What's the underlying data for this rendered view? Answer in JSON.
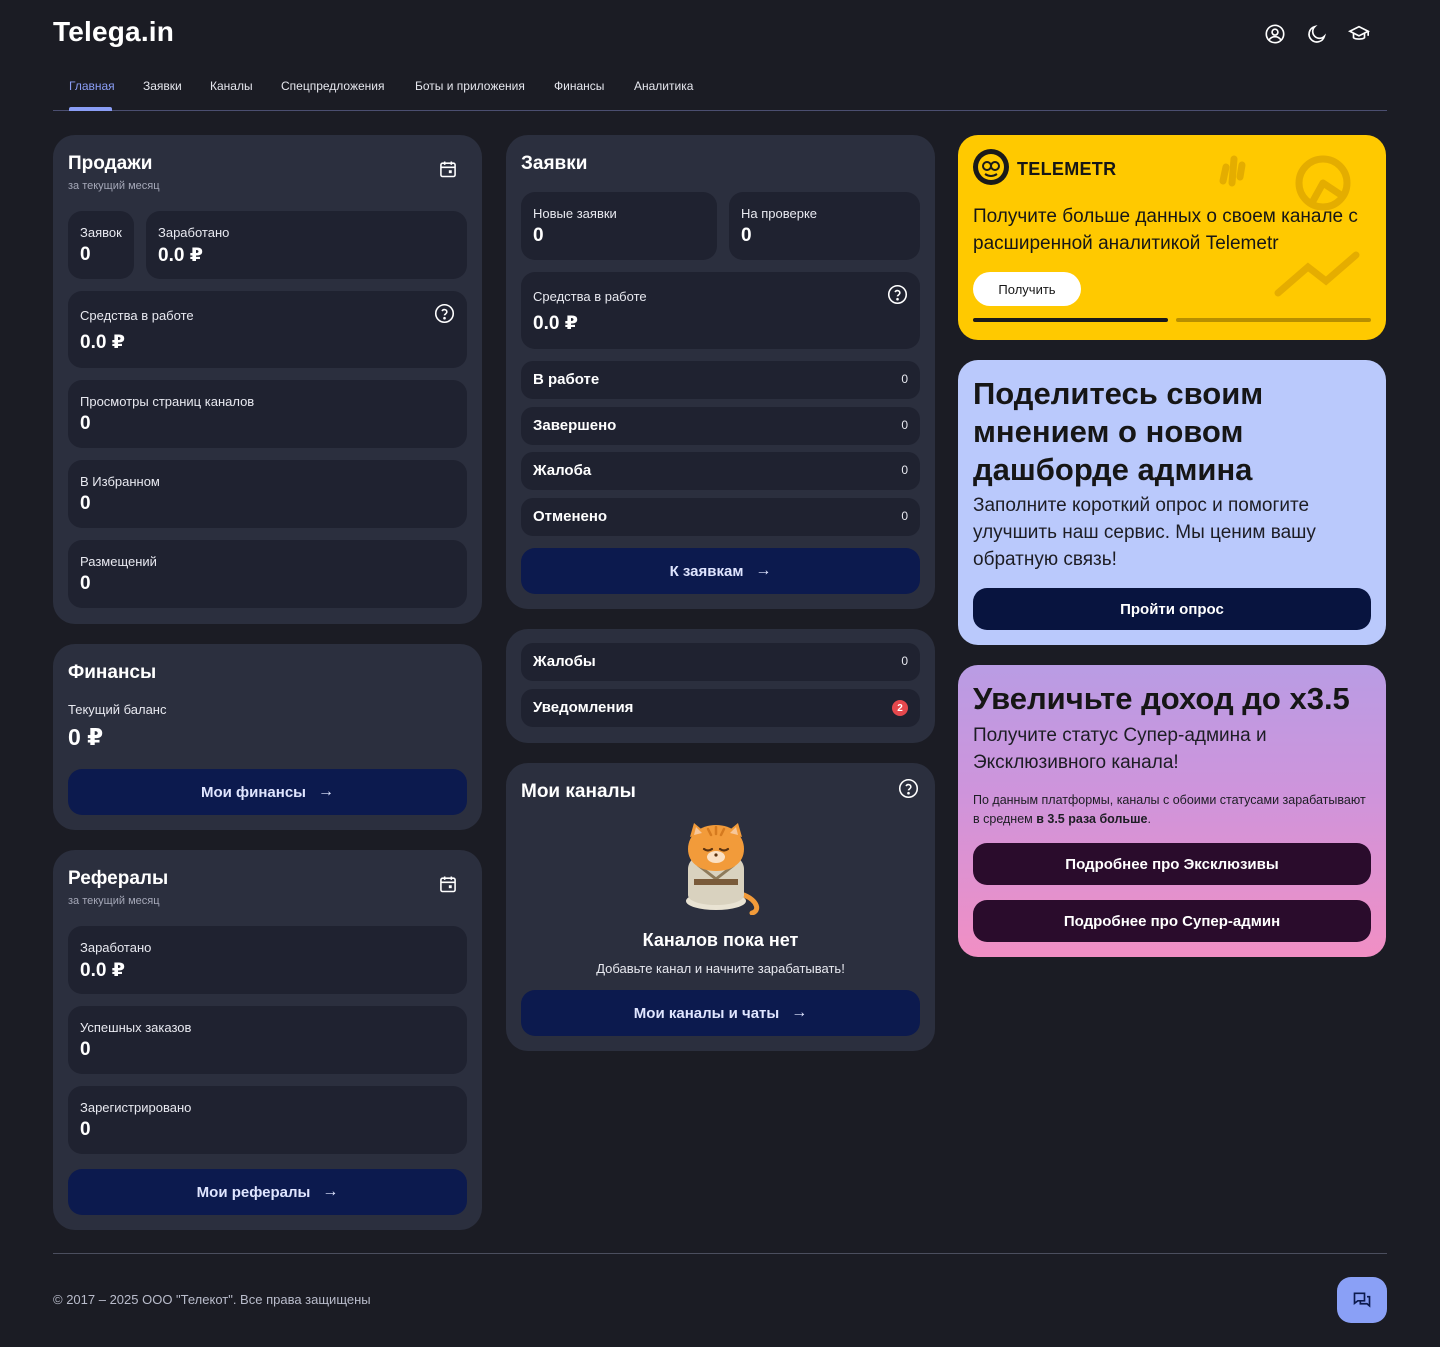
{
  "app": {
    "logo": "Telega.in"
  },
  "header_icons": [
    "user-circle-icon",
    "moon-icon",
    "graduation-cap-icon"
  ],
  "nav": {
    "items": [
      {
        "label": "Главная",
        "active": true
      },
      {
        "label": "Заявки"
      },
      {
        "label": "Каналы"
      },
      {
        "label": "Спецпредложения"
      },
      {
        "label": "Боты и приложения"
      },
      {
        "label": "Финансы"
      },
      {
        "label": "Аналитика"
      }
    ]
  },
  "sales": {
    "title": "Продажи",
    "subtitle": "за текущий месяц",
    "tiles": [
      {
        "label": "Заявок",
        "value": "0"
      },
      {
        "label": "Заработано",
        "value": "0.0 ₽"
      },
      {
        "label": "Средства в работе",
        "value": "0.0 ₽"
      },
      {
        "label": "Просмотры страниц каналов",
        "value": "0"
      },
      {
        "label": "В Избранном",
        "value": "0"
      },
      {
        "label": "Размещений",
        "value": "0"
      }
    ]
  },
  "finances": {
    "title": "Финансы",
    "balance_label": "Текущий баланс",
    "balance_value": "0 ₽",
    "button": "Мои финансы"
  },
  "referrals": {
    "title": "Рефералы",
    "subtitle": "за текущий месяц",
    "tiles": [
      {
        "label": "Заработано",
        "value": "0.0 ₽"
      },
      {
        "label": "Успешных заказов",
        "value": "0"
      },
      {
        "label": "Зарегистрировано",
        "value": "0"
      }
    ],
    "button": "Мои рефералы"
  },
  "requests": {
    "title": "Заявки",
    "tiles": [
      {
        "label": "Новые заявки",
        "value": "0"
      },
      {
        "label": "На проверке",
        "value": "0"
      },
      {
        "label": "Средства в работе",
        "value": "0.0 ₽"
      }
    ],
    "rows": [
      {
        "label": "В работе",
        "count": "0"
      },
      {
        "label": "Завершено",
        "count": "0"
      },
      {
        "label": "Жалоба",
        "count": "0"
      },
      {
        "label": "Отменено",
        "count": "0"
      }
    ],
    "button": "К заявкам"
  },
  "alerts": {
    "rows": [
      {
        "label": "Жалобы",
        "count": "0"
      },
      {
        "label": "Уведомления",
        "count": "2"
      }
    ]
  },
  "channels": {
    "title": "Мои каналы",
    "empty_title": "Каналов пока нет",
    "empty_text": "Добавьте канал и начните зарабатывать!",
    "button": "Мои каналы и чаты"
  },
  "telemetr": {
    "brand": "TELEMETR",
    "text": "Получите больше данных о своем канале с расширенной аналитикой Telemetr",
    "button": "Получить",
    "slide_progress": 1.0,
    "colors": {
      "bg": "#ffc900"
    }
  },
  "survey": {
    "title": "Поделитесь своим мнением о новом дашборде админа",
    "text": "Заполните короткий опрос и помогите улучшить наш сервис. Мы ценим вашу обратную связь!",
    "button": "Пройти опрос"
  },
  "income": {
    "title": "Увеличьте доход до x3.5",
    "text": "Получите статус Супер-админа и Эксклюзивного канала!",
    "small_text_1": "По данным платформы, каналы с обоими статусами зарабатывают в среднем ",
    "small_text_bold": "в 3.5 раза больше",
    "small_text_2": ".",
    "button_exclusive": "Подробнее про Эксклюзивы",
    "button_superadmin": "Подробнее про Супер-админ"
  },
  "footer": {
    "copyright": "© 2017 – 2025 ООО \"Телекот\". Все права защищены"
  },
  "colors": {
    "accent": "#8a9df5",
    "primary_button": "#0c1a4e",
    "card_bg": "#2b2f3e",
    "tile_bg": "#1f2230",
    "page_bg": "#1b1c24"
  }
}
